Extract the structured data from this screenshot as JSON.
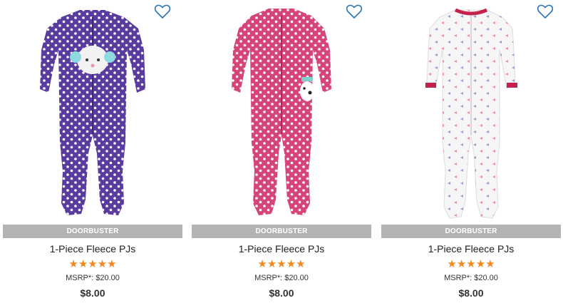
{
  "products": [
    {
      "badge": "DOORBUSTER",
      "name": "1-Piece Fleece PJs",
      "rating_stars": "★★★★★",
      "rating": 5,
      "msrp": "MSRP*: $20.00",
      "price": "$8.00",
      "colors": {
        "body": "#5a3c9e",
        "cuff": "#5a3c9e",
        "dots": "#ffffff"
      }
    },
    {
      "badge": "DOORBUSTER",
      "name": "1-Piece Fleece PJs",
      "rating_stars": "★★★★★",
      "rating": 5,
      "msrp": "MSRP*: $20.00",
      "price": "$8.00",
      "colors": {
        "body": "#d6457a",
        "cuff": "#d6457a",
        "dots": "#ffffff"
      }
    },
    {
      "badge": "DOORBUSTER",
      "name": "1-Piece Fleece PJs",
      "rating_stars": "★★★★★",
      "rating": 5,
      "msrp": "MSRP*: $20.00",
      "price": "$8.00",
      "colors": {
        "body": "#f6f6f6",
        "cuff": "#c4224e",
        "dots": "#8fa0d8"
      }
    }
  ],
  "icons": {
    "wishlist": "heart-outline-icon"
  },
  "accent": {
    "heart": "#2a74b8",
    "stars": "#f2871e",
    "badge_bg": "#b3b3b3"
  }
}
